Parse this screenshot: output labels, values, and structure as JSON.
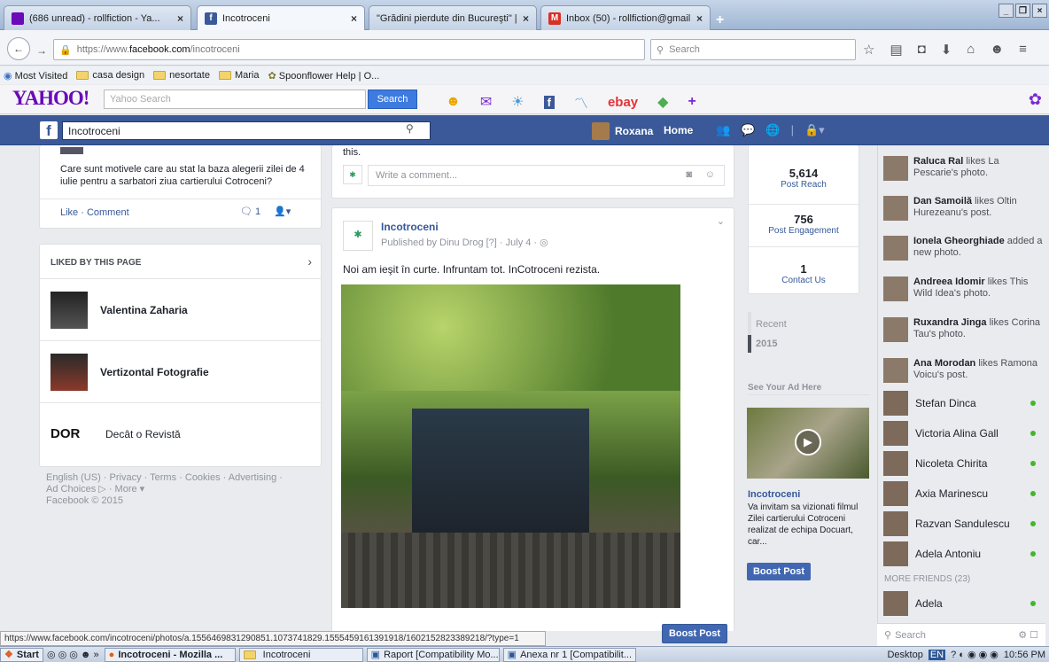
{
  "browser": {
    "tabs": [
      {
        "title": "(686 unread) - rollfiction - Ya...",
        "icon": "yahoo-mail-icon",
        "color": "#6a0ab8"
      },
      {
        "title": "Incotroceni",
        "icon": "facebook-icon",
        "color": "#3b5998"
      },
      {
        "title": "\"Grădini pierdute din Bucureşti\" | B...",
        "icon": "blank-icon",
        "color": "#ffffff"
      },
      {
        "title": "Inbox (50) - rollfiction@gmail....",
        "icon": "gmail-icon",
        "color": "#d93025"
      }
    ],
    "new_tab": "+",
    "url_prefix": "https://www.",
    "url_domain": "facebook.com",
    "url_path": "/incotroceni",
    "search_placeholder": "Search",
    "bookmarks": [
      "Most Visited",
      "casa design",
      "nesortate",
      "Maria",
      "Spoonflower Help | O..."
    ]
  },
  "yahoo": {
    "logo": "YAHOO!",
    "search_placeholder": "Yahoo Search",
    "search_button": "Search",
    "ebay": "ebay"
  },
  "fb_header": {
    "search_value": "Incotroceni",
    "user": "Roxana",
    "home": "Home"
  },
  "left": {
    "question": "Care sunt motivele care au stat la baza alegerii zilei de 4 iulie pentru a sarbatori ziua cartierului Cotroceni?",
    "like_comment": "Like · Comment",
    "comment_count": "1",
    "liked_title": "LIKED BY THIS PAGE",
    "liked": [
      {
        "name": "Valentina Zaharia"
      },
      {
        "name": "Vertizontal Fotografie"
      },
      {
        "name": "Decât o Revistă",
        "logo": "DOR"
      }
    ],
    "footer_line1": "English (US) · Privacy · Terms · Cookies · Advertising ·",
    "footer_line2": "Ad Choices ▷ · More ▾",
    "footer_line3": "Facebook © 2015"
  },
  "center": {
    "partial_text": "this.",
    "write_comment": "Write a comment...",
    "post_page": "Incotroceni",
    "post_meta": "Published by Dinu Drog [?] · July 4 · ",
    "post_text": "Noi am ieşit în curte. Infruntam tot. InCotroceni rezista.",
    "boost": "Boost Post"
  },
  "insights": {
    "stats": [
      {
        "n": "5,614",
        "l": "Post Reach"
      },
      {
        "n": "756",
        "l": "Post Engagement"
      },
      {
        "n": "1",
        "l": "Contact Us"
      }
    ],
    "recent": "Recent",
    "year": "2015",
    "see_ad": "See Your Ad Here",
    "ad_title": "Incotroceni",
    "ad_text": "Va invitam sa vizionati filmul Zilei cartierului Cotroceni realizat de echipa Docuart, car...",
    "ad_boost": "Boost Post"
  },
  "ticker": [
    {
      "name": "Raluca Ral",
      "rest": " likes La Pescarie's photo."
    },
    {
      "name": "Dan Samoilă",
      "rest": " likes Oltin Hurezeanu's post."
    },
    {
      "name": "Ionela Gheorghiade",
      "rest": " added a new photo."
    },
    {
      "name": "Andreea Idomir",
      "rest": " likes This Wild Idea's photo."
    },
    {
      "name": "Ruxandra Jinga",
      "rest": " likes Corina Tau's photo."
    },
    {
      "name": "Ana Morodan",
      "rest": " likes Ramona Voicu's post."
    }
  ],
  "chat": [
    "Stefan Dinca",
    "Victoria Alina Gall",
    "Nicoleta Chirita",
    "Axia Marinescu",
    "Razvan Sandulescu",
    "Adela Antoniu"
  ],
  "more_friends": "MORE FRIENDS (23)",
  "chat_extra": "Adela",
  "chat_search": "Search",
  "status_url": "https://www.facebook.com/incotroceni/photos/a.1556469831290851.1073741829.1555459161391918/1602152823389218/?type=1",
  "taskbar": {
    "start": "Start",
    "items": [
      "Incotroceni - Mozilla ...",
      "Incotroceni",
      "Raport [Compatibility Mo...",
      "Anexa nr 1 [Compatibilit..."
    ],
    "desktop": "Desktop",
    "lang": "EN",
    "time": "10:56 PM"
  }
}
